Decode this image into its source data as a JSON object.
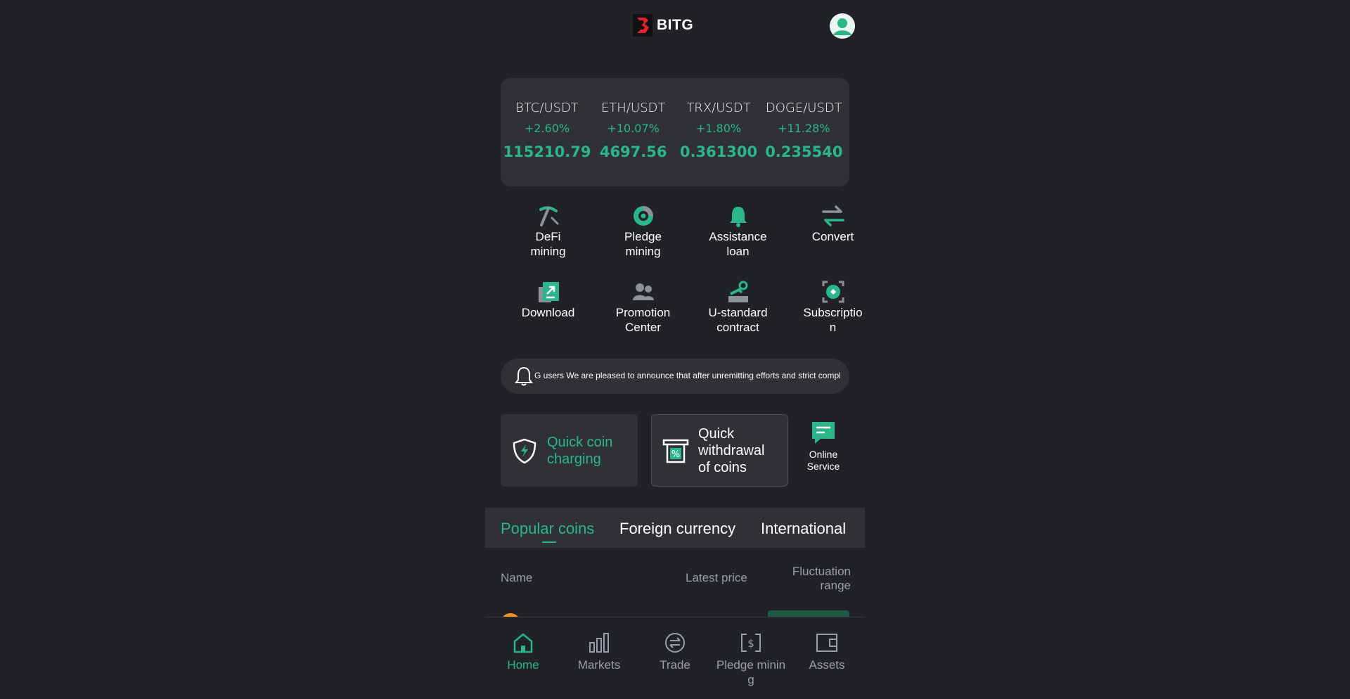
{
  "brand": {
    "name": "BITG",
    "accent": "#2bb68a",
    "logo_color": "#e0212e"
  },
  "header": {
    "avatar_icon": "user-avatar-icon"
  },
  "tickers": [
    {
      "pair": "BTC/USDT",
      "change": "+2.60%",
      "price": "115210.79"
    },
    {
      "pair": "ETH/USDT",
      "change": "+10.07%",
      "price": "4697.56"
    },
    {
      "pair": "TRX/USDT",
      "change": "+1.80%",
      "price": "0.361300"
    },
    {
      "pair": "DOGE/USDT",
      "change": "+11.28%",
      "price": "0.235540"
    }
  ],
  "features": [
    {
      "label": "DeFi mining",
      "icon": "pickaxe-icon"
    },
    {
      "label": "Pledge mining",
      "icon": "pledge-icon"
    },
    {
      "label": "Assistance loan",
      "icon": "bell-icon"
    },
    {
      "label": "Convert",
      "icon": "convert-arrows-icon"
    },
    {
      "label": "Download",
      "icon": "download-icon"
    },
    {
      "label": "Promotion Center",
      "icon": "users-icon"
    },
    {
      "label": "U-standard contract",
      "icon": "contract-icon"
    },
    {
      "label": "Subscription",
      "icon": "subscription-icon"
    }
  ],
  "notice": {
    "text": "G users We are pleased to announce that after unremitting efforts and strict complian",
    "icon": "bell-outline-icon"
  },
  "quick_actions": {
    "charge_label": "Quick coin charging",
    "withdraw_label": "Quick withdrawal of coins",
    "service_label": "Online Service"
  },
  "tabs": [
    "Popular coins",
    "Foreign currency",
    "International"
  ],
  "table": {
    "col_name": "Name",
    "col_price": "Latest price",
    "col_range": "Fluctuation range"
  },
  "bottom_nav": [
    {
      "label": "Home",
      "icon": "home-icon"
    },
    {
      "label": "Markets",
      "icon": "markets-bars-icon"
    },
    {
      "label": "Trade",
      "icon": "trade-icon"
    },
    {
      "label": "Pledge mining",
      "icon": "pledge-dollar-icon"
    },
    {
      "label": "Assets",
      "icon": "wallet-icon"
    }
  ]
}
